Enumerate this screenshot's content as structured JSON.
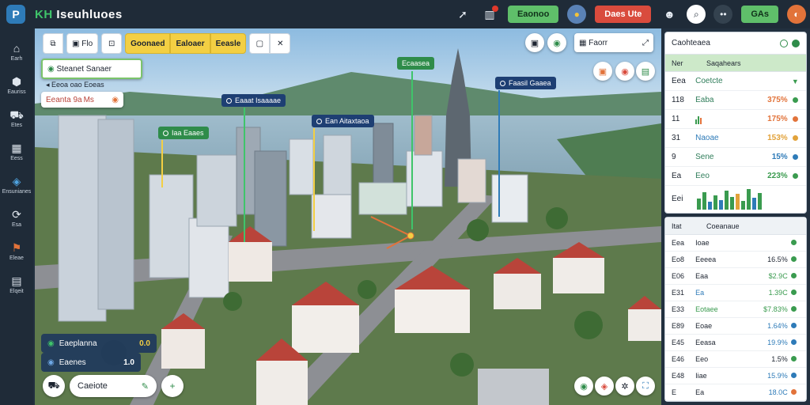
{
  "app": {
    "title_prefix": "KH",
    "title": "Iseuhluoes",
    "logo_letter": "P"
  },
  "topbar": {
    "btn_green_label": "Eaonoo",
    "btn_red_label": "Daes Ute",
    "btn_green2_label": "GAs"
  },
  "sidebar": {
    "items": [
      {
        "icon": "house-icon",
        "glyph": "⌂",
        "label": "Earh"
      },
      {
        "icon": "hexagon-icon",
        "glyph": "⬢",
        "label": "Eauriss"
      },
      {
        "icon": "car-icon",
        "glyph": "⛟",
        "label": "Etes"
      },
      {
        "icon": "grid-icon",
        "glyph": "▦",
        "label": "Eess"
      },
      {
        "icon": "layers-icon",
        "glyph": "◈",
        "label": "Ensunianes"
      },
      {
        "icon": "route-icon",
        "glyph": "⟳",
        "label": "Esa"
      },
      {
        "icon": "flag-icon",
        "glyph": "⚑",
        "label": "Eleae"
      },
      {
        "icon": "chart-icon",
        "glyph": "▤",
        "label": "Elqeit"
      }
    ]
  },
  "toolbar": {
    "tool_a": "Flo",
    "tool_b": "Goonaed",
    "tool_c": "Ealoaer",
    "tool_d": "Eeasle"
  },
  "map": {
    "search_card_title": "Steanet Sanaer",
    "search_card_sub": "Eeoa oao Eoeas",
    "tag_card": "Eeanta 9a Ms",
    "top_right_label": "Faorr",
    "pins": [
      {
        "label": "Ecaasea"
      },
      {
        "label": "Faasil Gaaea"
      },
      {
        "label": "Eaaat Isaaaae"
      },
      {
        "label": "Ean Aitaxtaoa"
      },
      {
        "label": "Iaa Eaaes"
      }
    ],
    "legend": [
      {
        "label": "Eaeplanna",
        "value": "0.0"
      },
      {
        "label": "Eaenes",
        "value": "1.0"
      }
    ],
    "bottom_pill": "Caeiote"
  },
  "panel_top": {
    "title": "Caohteaea",
    "col_a": "Ner",
    "col_b": "Saqahears",
    "rows": [
      {
        "a": "Eea",
        "b": "Coetcte",
        "c": "",
        "ind_color": "#3a9b4f",
        "ind": "▼"
      },
      {
        "a": "118",
        "b": "Eaba",
        "c": "375%",
        "ind_color": "#3a9b4f",
        "ind": "◉"
      },
      {
        "a": "11",
        "b": "",
        "c": "175%",
        "ind_color": "#e2733a",
        "ind": "◉",
        "spark": true
      },
      {
        "a": "31",
        "b": "Naoae",
        "c": "153%",
        "ind_color": "#e2a23a",
        "ind": "◉"
      },
      {
        "a": "9",
        "b": "Sene",
        "c": "15%",
        "ind_color": "#2e7bb8",
        "ind": "◉"
      },
      {
        "a": "Ea",
        "b": "Eeo",
        "c": "223%",
        "ind_color": "#3a9b4f",
        "ind": "◉"
      }
    ],
    "chart_row_label": "Eei"
  },
  "panel_bottom": {
    "col_a": "Itat",
    "col_b": "Coeanaue",
    "rows": [
      {
        "a": "Eea",
        "b": "Ioae",
        "c": "",
        "ind_color": "#3a9b4f"
      },
      {
        "a": "Eo8",
        "b": "Eeeea",
        "c": "16.5%",
        "ind_color": "#3a9b4f"
      },
      {
        "a": "E06",
        "b": "Eaa",
        "c": "$2.9C",
        "ind_color": "#3a9b4f"
      },
      {
        "a": "E31",
        "b": "Ea",
        "c": "1.39C",
        "ind_color": "#3a9b4f"
      },
      {
        "a": "E33",
        "b": "Eotaee",
        "c": "$7.83%",
        "ind_color": "#3a9b4f"
      },
      {
        "a": "E89",
        "b": "Eoae",
        "c": "1.64%",
        "ind_color": "#2e7bb8"
      },
      {
        "a": "E45",
        "b": "Eeasa",
        "c": "19.9%",
        "ind_color": "#2e7bb8"
      },
      {
        "a": "E46",
        "b": "Eeo",
        "c": "1.5%",
        "ind_color": "#3a9b4f"
      },
      {
        "a": "E48",
        "b": "Iiae",
        "c": "15.9%",
        "ind_color": "#2e7bb8"
      },
      {
        "a": "E",
        "b": "Ea",
        "c": "18.0C",
        "ind_color": "#e2733a"
      }
    ]
  }
}
